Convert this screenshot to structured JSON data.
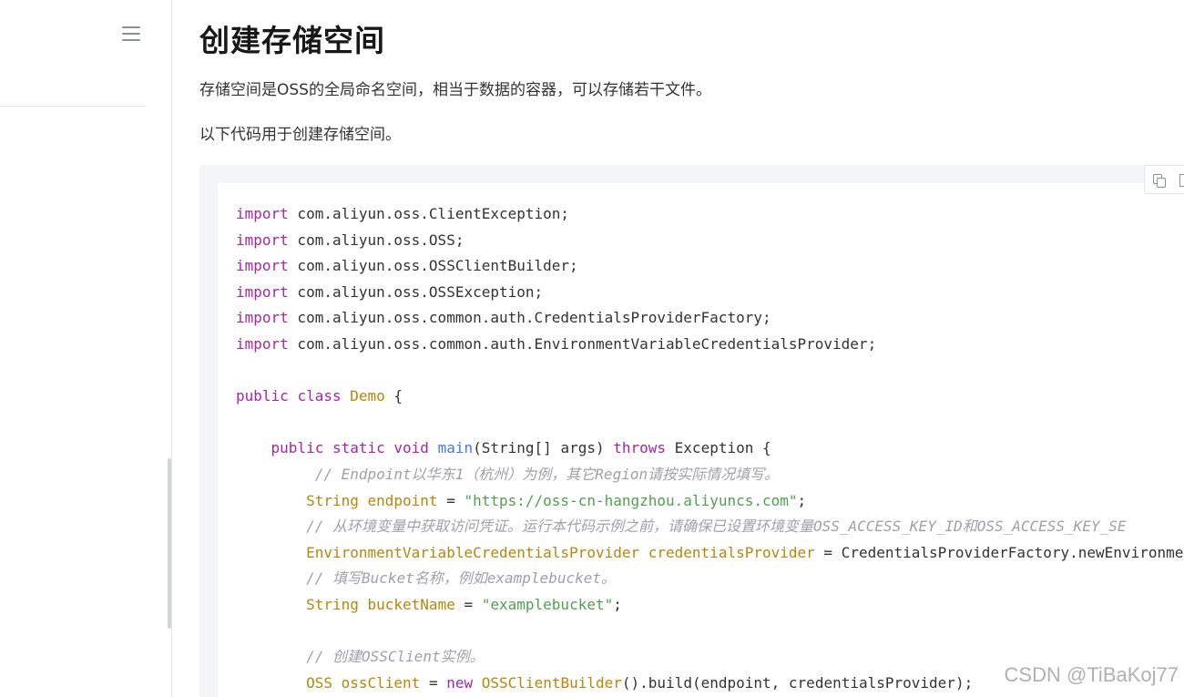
{
  "page": {
    "title": "创建存储空间",
    "para1": "存储空间是OSS的全局命名空间，相当于数据的容器，可以存储若干文件。",
    "para2": "以下代码用于创建存储空间。"
  },
  "code_block": {
    "language": "java",
    "lines": [
      [
        {
          "t": "kw",
          "v": "import"
        },
        {
          "t": "p",
          "v": " com.aliyun.oss.ClientException;"
        }
      ],
      [
        {
          "t": "kw",
          "v": "import"
        },
        {
          "t": "p",
          "v": " com.aliyun.oss.OSS;"
        }
      ],
      [
        {
          "t": "kw",
          "v": "import"
        },
        {
          "t": "p",
          "v": " com.aliyun.oss.OSSClientBuilder;"
        }
      ],
      [
        {
          "t": "kw",
          "v": "import"
        },
        {
          "t": "p",
          "v": " com.aliyun.oss.OSSException;"
        }
      ],
      [
        {
          "t": "kw",
          "v": "import"
        },
        {
          "t": "p",
          "v": " com.aliyun.oss.common.auth.CredentialsProviderFactory;"
        }
      ],
      [
        {
          "t": "kw",
          "v": "import"
        },
        {
          "t": "p",
          "v": " com.aliyun.oss.common.auth.EnvironmentVariableCredentialsProvider;"
        }
      ],
      [],
      [
        {
          "t": "kw",
          "v": "public"
        },
        {
          "t": "p",
          "v": " "
        },
        {
          "t": "kw",
          "v": "class"
        },
        {
          "t": "p",
          "v": " "
        },
        {
          "t": "cls",
          "v": "Demo"
        },
        {
          "t": "p",
          "v": " {"
        }
      ],
      [],
      [
        {
          "t": "p",
          "v": "    "
        },
        {
          "t": "kw",
          "v": "public"
        },
        {
          "t": "p",
          "v": " "
        },
        {
          "t": "kw",
          "v": "static"
        },
        {
          "t": "p",
          "v": " "
        },
        {
          "t": "kw",
          "v": "void"
        },
        {
          "t": "p",
          "v": " "
        },
        {
          "t": "fn",
          "v": "main"
        },
        {
          "t": "p",
          "v": "(String[] args) "
        },
        {
          "t": "kw",
          "v": "throws"
        },
        {
          "t": "p",
          "v": " Exception {"
        }
      ],
      [
        {
          "t": "p",
          "v": "         "
        },
        {
          "t": "cm",
          "v": "// Endpoint以华东1（杭州）为例，其它Region请按实际情况填写。"
        }
      ],
      [
        {
          "t": "p",
          "v": "        "
        },
        {
          "t": "cls",
          "v": "String"
        },
        {
          "t": "p",
          "v": " "
        },
        {
          "t": "cls",
          "v": "endpoint"
        },
        {
          "t": "p",
          "v": " = "
        },
        {
          "t": "str",
          "v": "\"https://oss-cn-hangzhou.aliyuncs.com\""
        },
        {
          "t": "p",
          "v": ";"
        }
      ],
      [
        {
          "t": "p",
          "v": "        "
        },
        {
          "t": "cm",
          "v": "// 从环境变量中获取访问凭证。运行本代码示例之前，请确保已设置环境变量OSS_ACCESS_KEY_ID和OSS_ACCESS_KEY_SE"
        }
      ],
      [
        {
          "t": "p",
          "v": "        "
        },
        {
          "t": "cls",
          "v": "EnvironmentVariableCredentialsProvider"
        },
        {
          "t": "p",
          "v": " "
        },
        {
          "t": "cls",
          "v": "credentialsProvider"
        },
        {
          "t": "p",
          "v": " = CredentialsProviderFactory.newEnvironme"
        }
      ],
      [
        {
          "t": "p",
          "v": "        "
        },
        {
          "t": "cm",
          "v": "// 填写Bucket名称，例如examplebucket。"
        }
      ],
      [
        {
          "t": "p",
          "v": "        "
        },
        {
          "t": "cls",
          "v": "String"
        },
        {
          "t": "p",
          "v": " "
        },
        {
          "t": "cls",
          "v": "bucketName"
        },
        {
          "t": "p",
          "v": " = "
        },
        {
          "t": "str",
          "v": "\"examplebucket\""
        },
        {
          "t": "p",
          "v": ";"
        }
      ],
      [],
      [
        {
          "t": "p",
          "v": "        "
        },
        {
          "t": "cm",
          "v": "// 创建OSSClient实例。"
        }
      ],
      [
        {
          "t": "p",
          "v": "        "
        },
        {
          "t": "cls",
          "v": "OSS"
        },
        {
          "t": "p",
          "v": " "
        },
        {
          "t": "cls",
          "v": "ossClient"
        },
        {
          "t": "p",
          "v": " = "
        },
        {
          "t": "kw",
          "v": "new"
        },
        {
          "t": "p",
          "v": " "
        },
        {
          "t": "cls",
          "v": "OSSClientBuilder"
        },
        {
          "t": "p",
          "v": "().build(endpoint, credentialsProvider);"
        }
      ]
    ]
  },
  "watermark": "CSDN @TiBaKoj77",
  "icons": {
    "menu": "hamburger-menu-icon",
    "copy": "copy-icon",
    "expand": "expand-icon"
  },
  "colors": {
    "keyword": "#a626a4",
    "class": "#b8860b",
    "function": "#4078f2",
    "string": "#50a14f",
    "comment": "#a0a1a7",
    "code_bg": "#f3f5f7"
  }
}
